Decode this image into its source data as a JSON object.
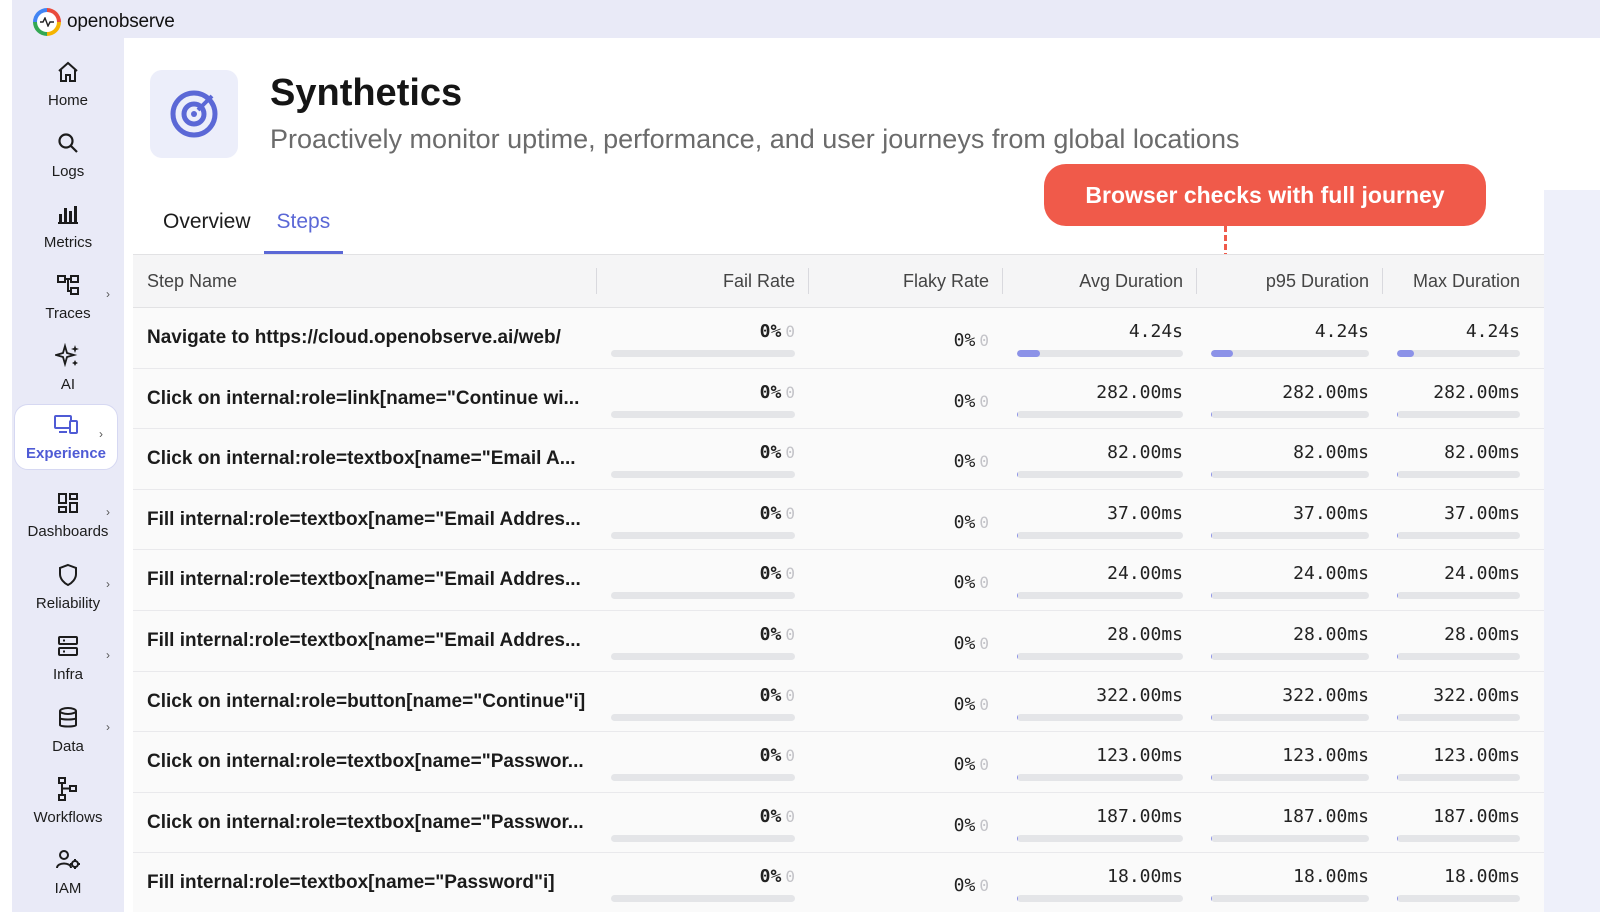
{
  "app": {
    "name": "openobserve"
  },
  "nav": [
    {
      "label": "Home",
      "icon": "home-icon",
      "has_chevron": false
    },
    {
      "label": "Logs",
      "icon": "search-icon",
      "has_chevron": false
    },
    {
      "label": "Metrics",
      "icon": "bar-chart-icon",
      "has_chevron": false
    },
    {
      "label": "Traces",
      "icon": "traces-icon",
      "has_chevron": true
    },
    {
      "label": "AI",
      "icon": "sparkle-icon",
      "has_chevron": false
    },
    {
      "label": "Experience",
      "icon": "devices-icon",
      "has_chevron": true,
      "active": true
    },
    {
      "label": "Dashboards",
      "icon": "dashboard-icon",
      "has_chevron": true
    },
    {
      "label": "Reliability",
      "icon": "shield-icon",
      "has_chevron": true
    },
    {
      "label": "Infra",
      "icon": "server-icon",
      "has_chevron": true
    },
    {
      "label": "Data",
      "icon": "database-icon",
      "has_chevron": true
    },
    {
      "label": "Workflows",
      "icon": "workflow-icon",
      "has_chevron": false
    },
    {
      "label": "IAM",
      "icon": "users-gear-icon",
      "has_chevron": false
    }
  ],
  "header": {
    "title": "Synthetics",
    "subtitle": "Proactively monitor uptime, performance, and user journeys from global locations",
    "icon": "target-icon"
  },
  "callout": {
    "text": "Browser checks with full journey"
  },
  "tabs": [
    {
      "label": "Overview",
      "active": false
    },
    {
      "label": "Steps",
      "active": true
    }
  ],
  "table": {
    "columns": [
      "Step Name",
      "Fail Rate",
      "Flaky Rate",
      "Avg Duration",
      "p95 Duration",
      "Max Duration"
    ],
    "zero_hint": "0",
    "rows": [
      {
        "name": "Navigate to https://cloud.openobserve.ai/web/",
        "fail": "0%",
        "flaky": "0%",
        "avg": "4.24s",
        "p95": "4.24s",
        "max": "4.24s",
        "bar_fraction": 0.14
      },
      {
        "name": "Click on internal:role=link[name=\"Continue wi...",
        "fail": "0%",
        "flaky": "0%",
        "avg": "282.00ms",
        "p95": "282.00ms",
        "max": "282.00ms",
        "bar_fraction": 0.0
      },
      {
        "name": "Click on internal:role=textbox[name=\"Email A...",
        "fail": "0%",
        "flaky": "0%",
        "avg": "82.00ms",
        "p95": "82.00ms",
        "max": "82.00ms",
        "bar_fraction": 0.0
      },
      {
        "name": "Fill internal:role=textbox[name=\"Email Addres...",
        "fail": "0%",
        "flaky": "0%",
        "avg": "37.00ms",
        "p95": "37.00ms",
        "max": "37.00ms",
        "bar_fraction": 0.0
      },
      {
        "name": "Fill internal:role=textbox[name=\"Email Addres...",
        "fail": "0%",
        "flaky": "0%",
        "avg": "24.00ms",
        "p95": "24.00ms",
        "max": "24.00ms",
        "bar_fraction": 0.0
      },
      {
        "name": "Fill internal:role=textbox[name=\"Email Addres...",
        "fail": "0%",
        "flaky": "0%",
        "avg": "28.00ms",
        "p95": "28.00ms",
        "max": "28.00ms",
        "bar_fraction": 0.0
      },
      {
        "name": "Click on internal:role=button[name=\"Continue\"i]",
        "fail": "0%",
        "flaky": "0%",
        "avg": "322.00ms",
        "p95": "322.00ms",
        "max": "322.00ms",
        "bar_fraction": 0.0
      },
      {
        "name": "Click on internal:role=textbox[name=\"Passwor...",
        "fail": "0%",
        "flaky": "0%",
        "avg": "123.00ms",
        "p95": "123.00ms",
        "max": "123.00ms",
        "bar_fraction": 0.0
      },
      {
        "name": "Click on internal:role=textbox[name=\"Passwor...",
        "fail": "0%",
        "flaky": "0%",
        "avg": "187.00ms",
        "p95": "187.00ms",
        "max": "187.00ms",
        "bar_fraction": 0.0
      },
      {
        "name": "Fill internal:role=textbox[name=\"Password\"i]",
        "fail": "0%",
        "flaky": "0%",
        "avg": "18.00ms",
        "p95": "18.00ms",
        "max": "18.00ms",
        "bar_fraction": 0.0
      }
    ]
  },
  "colors": {
    "accent": "#5b68d6",
    "callout": "#f05a4a",
    "bar": "#8c92e8"
  }
}
